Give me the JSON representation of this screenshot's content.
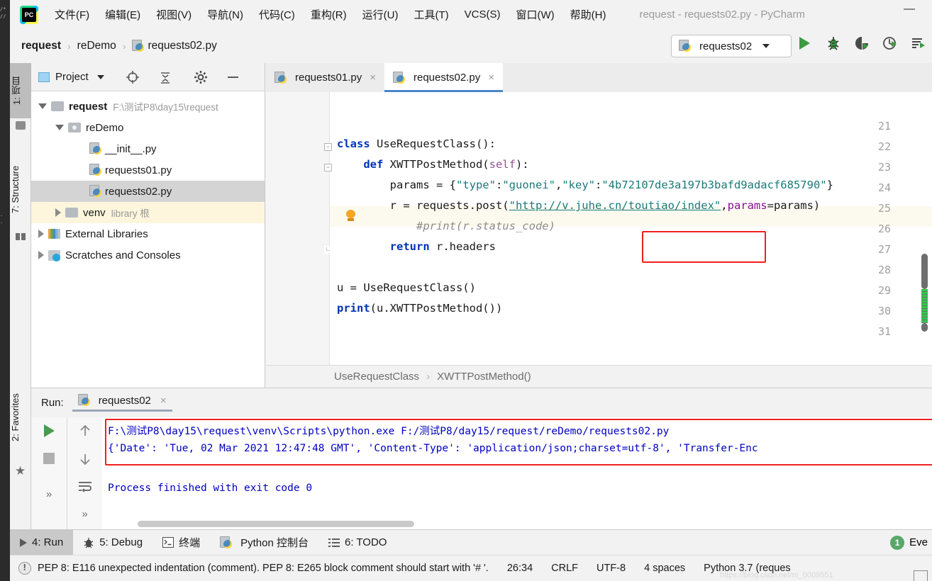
{
  "window": {
    "app_logo": "pycharm-logo-icon",
    "title": "request - requests02.py - PyCharm",
    "minimize": "minimize-icon"
  },
  "menubar": {
    "items": [
      {
        "label": "文件(F)",
        "mnemonic": "F"
      },
      {
        "label": "编辑(E)",
        "mnemonic": "E"
      },
      {
        "label": "视图(V)",
        "mnemonic": "V"
      },
      {
        "label": "导航(N)",
        "mnemonic": "N"
      },
      {
        "label": "代码(C)",
        "mnemonic": "C"
      },
      {
        "label": "重构(R)",
        "mnemonic": "R"
      },
      {
        "label": "运行(U)",
        "mnemonic": "U"
      },
      {
        "label": "工具(T)",
        "mnemonic": "T"
      },
      {
        "label": "VCS(S)",
        "mnemonic": "S"
      },
      {
        "label": "窗口(W)",
        "mnemonic": "W"
      },
      {
        "label": "帮助(H)",
        "mnemonic": "H"
      }
    ]
  },
  "navbar": {
    "breadcrumbs": [
      "request",
      "reDemo",
      "requests02.py"
    ],
    "separator": "›",
    "file_icon": "python-file-icon"
  },
  "toolbar": {
    "run_config": "requests02",
    "run_config_icon": "python-icon",
    "dropdown_icon": "chevron-down-icon",
    "buttons": [
      {
        "name": "run-button",
        "icon": "play-icon"
      },
      {
        "name": "debug-button",
        "icon": "bug-icon"
      },
      {
        "name": "run-with-coverage-button",
        "icon": "coverage-icon"
      },
      {
        "name": "profile-button",
        "icon": "profiler-icon"
      },
      {
        "name": "more-run-button",
        "icon": "run-list-icon"
      }
    ]
  },
  "left_strip": {
    "tabs": [
      {
        "label": "1: 项目",
        "active": true,
        "icon": "project-folder-icon"
      },
      {
        "label": "7: Structure",
        "active": false,
        "icon": "structure-icon"
      },
      {
        "label": "2: Favorites",
        "active": false,
        "icon": "star-icon"
      }
    ]
  },
  "project_panel": {
    "title": "Project",
    "header_icons": [
      "project-view-icon",
      "chevron-down-icon",
      "locate-icon",
      "collapse-all-icon",
      "gear-icon",
      "hide-icon"
    ],
    "tree": [
      {
        "label": "request",
        "path": "F:\\测试P8\\day15\\request",
        "depth": 0,
        "expanded": true,
        "bold": true,
        "icon": "folder-icon",
        "state": "normal"
      },
      {
        "label": "reDemo",
        "path": "",
        "depth": 1,
        "expanded": true,
        "bold": false,
        "icon": "source-folder-icon",
        "state": "normal"
      },
      {
        "label": "__init__.py",
        "path": "",
        "depth": 2,
        "expanded": null,
        "bold": false,
        "icon": "python-file-icon",
        "state": "normal"
      },
      {
        "label": "requests01.py",
        "path": "",
        "depth": 2,
        "expanded": null,
        "bold": false,
        "icon": "python-file-icon",
        "state": "normal"
      },
      {
        "label": "requests02.py",
        "path": "",
        "depth": 2,
        "expanded": null,
        "bold": false,
        "icon": "python-file-icon",
        "state": "selected"
      },
      {
        "label": "venv",
        "path": "library 根",
        "depth": 1,
        "expanded": false,
        "bold": false,
        "icon": "folder-icon",
        "state": "highlighted"
      },
      {
        "label": "External Libraries",
        "path": "",
        "depth": 0,
        "expanded": false,
        "bold": false,
        "icon": "libraries-icon",
        "state": "normal"
      },
      {
        "label": "Scratches and Consoles",
        "path": "",
        "depth": 0,
        "expanded": false,
        "bold": false,
        "icon": "scratches-icon",
        "state": "normal"
      }
    ]
  },
  "editor": {
    "tabs": [
      {
        "label": "requests01.py",
        "icon": "python-file-icon",
        "active": false,
        "close": "×"
      },
      {
        "label": "requests02.py",
        "icon": "python-file-icon",
        "active": true,
        "close": "×"
      }
    ],
    "first_line_number": 21,
    "lines": [
      {
        "num": "21",
        "text": ""
      },
      {
        "num": "22",
        "text": "class UseRequestClass():"
      },
      {
        "num": "23",
        "text": "    def XWTTPostMethod(self):"
      },
      {
        "num": "24",
        "text": "        params = {\"type\":\"guonei\",\"key\":\"4b72107de3a197b3bafd9adacf685790\"}"
      },
      {
        "num": "25",
        "text": "        r = requests.post(\"http://v.juhe.cn/toutiao/index\",params=params)"
      },
      {
        "num": "26",
        "text": "            #print(r.status_code)"
      },
      {
        "num": "27",
        "text": "        return r.headers"
      },
      {
        "num": "28",
        "text": ""
      },
      {
        "num": "29",
        "text": "u = UseRequestClass()"
      },
      {
        "num": "30",
        "text": "print(u.XWTTPostMethod())"
      },
      {
        "num": "31",
        "text": ""
      }
    ],
    "highlighted_line": "26",
    "intention_bulb": "lightbulb-icon",
    "annotation_box_target": "r.headers",
    "breadcrumbs": [
      "UseRequestClass",
      "XWTTPostMethod()"
    ],
    "breadcrumb_separator": "›"
  },
  "run_panel": {
    "label": "Run:",
    "tab_label": "requests02",
    "tab_icon": "python-icon",
    "tab_close": "×",
    "tools_left": [
      {
        "name": "rerun-button",
        "icon": "play-icon"
      },
      {
        "name": "stop-button",
        "icon": "stop-icon"
      },
      {
        "name": "expand-left-button",
        "icon": "chevrons-right-icon"
      }
    ],
    "tools_right": [
      {
        "name": "scroll-up-button",
        "icon": "arrow-up-icon"
      },
      {
        "name": "scroll-down-button",
        "icon": "arrow-down-icon"
      },
      {
        "name": "soft-wrap-button",
        "icon": "wrap-icon"
      },
      {
        "name": "expand-right-button",
        "icon": "chevrons-right-icon"
      }
    ],
    "console_lines": [
      "F:\\测试P8\\day15\\request\\venv\\Scripts\\python.exe F:/测试P8/day15/request/reDemo/requests02.py",
      "{'Date': 'Tue, 02 Mar 2021 12:47:48 GMT', 'Content-Type': 'application/json;charset=utf-8', 'Transfer-Enc",
      "",
      "Process finished with exit code 0"
    ]
  },
  "bottom_bar": {
    "tabs": [
      {
        "label": "4: Run",
        "icon": "play-icon",
        "active": true
      },
      {
        "label": "5: Debug",
        "icon": "bug-icon",
        "active": false
      },
      {
        "label": "终端",
        "icon": "terminal-icon",
        "active": false
      },
      {
        "label": "Python 控制台",
        "icon": "python-icon",
        "active": false
      },
      {
        "label": "6: TODO",
        "icon": "todo-icon",
        "active": false
      }
    ],
    "event_log": {
      "label": "Eve",
      "count": "1",
      "icon": "event-log-icon"
    }
  },
  "status_bar": {
    "warning_icon": "warning-icon",
    "message": "PEP 8: E116 unexpected indentation (comment). PEP 8: E265 block comment should start with '# '.",
    "caret_position": "26:34",
    "line_separator": "CRLF",
    "encoding": "UTF-8",
    "indent": "4 spaces",
    "interpreter": "Python 3.7 (reques",
    "watermark": "https://blog.csdn.net/m_0009551",
    "corner_icon": "resize-corner-icon"
  },
  "colors": {
    "accent_blue": "#4a86c8",
    "run_green": "#3c9a41",
    "annotation_red": "#ef2020",
    "selection_gray": "#d4d4d4",
    "highlight_yellow": "#fdf6dd",
    "console_blue": "#0000c0"
  }
}
